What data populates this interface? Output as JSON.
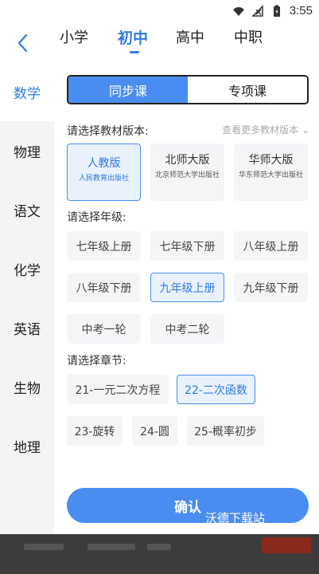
{
  "status_bar": {
    "time": "3:55",
    "icons": [
      "wifi-icon",
      "signal-off-icon",
      "battery-icon"
    ]
  },
  "nav": {
    "back_icon": "chevron-left-icon",
    "levels": [
      {
        "label": "小学",
        "active": false
      },
      {
        "label": "初中",
        "active": true
      },
      {
        "label": "高中",
        "active": false
      },
      {
        "label": "中职",
        "active": false
      }
    ]
  },
  "sidebar": {
    "items": [
      {
        "label": "数学",
        "active": true
      },
      {
        "label": "物理",
        "active": false
      },
      {
        "label": "语文",
        "active": false
      },
      {
        "label": "化学",
        "active": false
      },
      {
        "label": "英语",
        "active": false
      },
      {
        "label": "生物",
        "active": false
      },
      {
        "label": "地理",
        "active": false
      }
    ]
  },
  "segment": {
    "sync": "同步课",
    "special": "专项课"
  },
  "textbook": {
    "label": "请选择教材版本:",
    "more": "查看更多教材版本",
    "options": [
      {
        "name": "人教版",
        "publisher": "人民教育出版社",
        "selected": true
      },
      {
        "name": "北师大版",
        "publisher": "北京师范大学出版社",
        "selected": false
      },
      {
        "name": "华师大版",
        "publisher": "华东师范大学出版社",
        "selected": false
      }
    ]
  },
  "grade": {
    "label": "请选择年级:",
    "options": [
      {
        "label": "七年级上册",
        "selected": false
      },
      {
        "label": "七年级下册",
        "selected": false
      },
      {
        "label": "八年级上册",
        "selected": false
      },
      {
        "label": "八年级下册",
        "selected": false
      },
      {
        "label": "九年级上册",
        "selected": true
      },
      {
        "label": "九年级下册",
        "selected": false
      },
      {
        "label": "中考一轮",
        "selected": false
      },
      {
        "label": "中考二轮",
        "selected": false
      }
    ]
  },
  "chapter": {
    "label": "请选择章节:",
    "options": [
      {
        "label": "21-一元二次方程",
        "selected": false
      },
      {
        "label": "22-二次函数",
        "selected": true
      },
      {
        "label": "23-旋转",
        "selected": false
      },
      {
        "label": "24-圆",
        "selected": false
      },
      {
        "label": "25-概率初步",
        "selected": false
      }
    ]
  },
  "confirm": "确认",
  "watermark": "沃德下载站",
  "colors": {
    "accent": "#4a8df0",
    "accent_text": "#2f7be5",
    "chip_bg": "#f4f5f7",
    "sidebar_bg": "#f3f4f6"
  }
}
